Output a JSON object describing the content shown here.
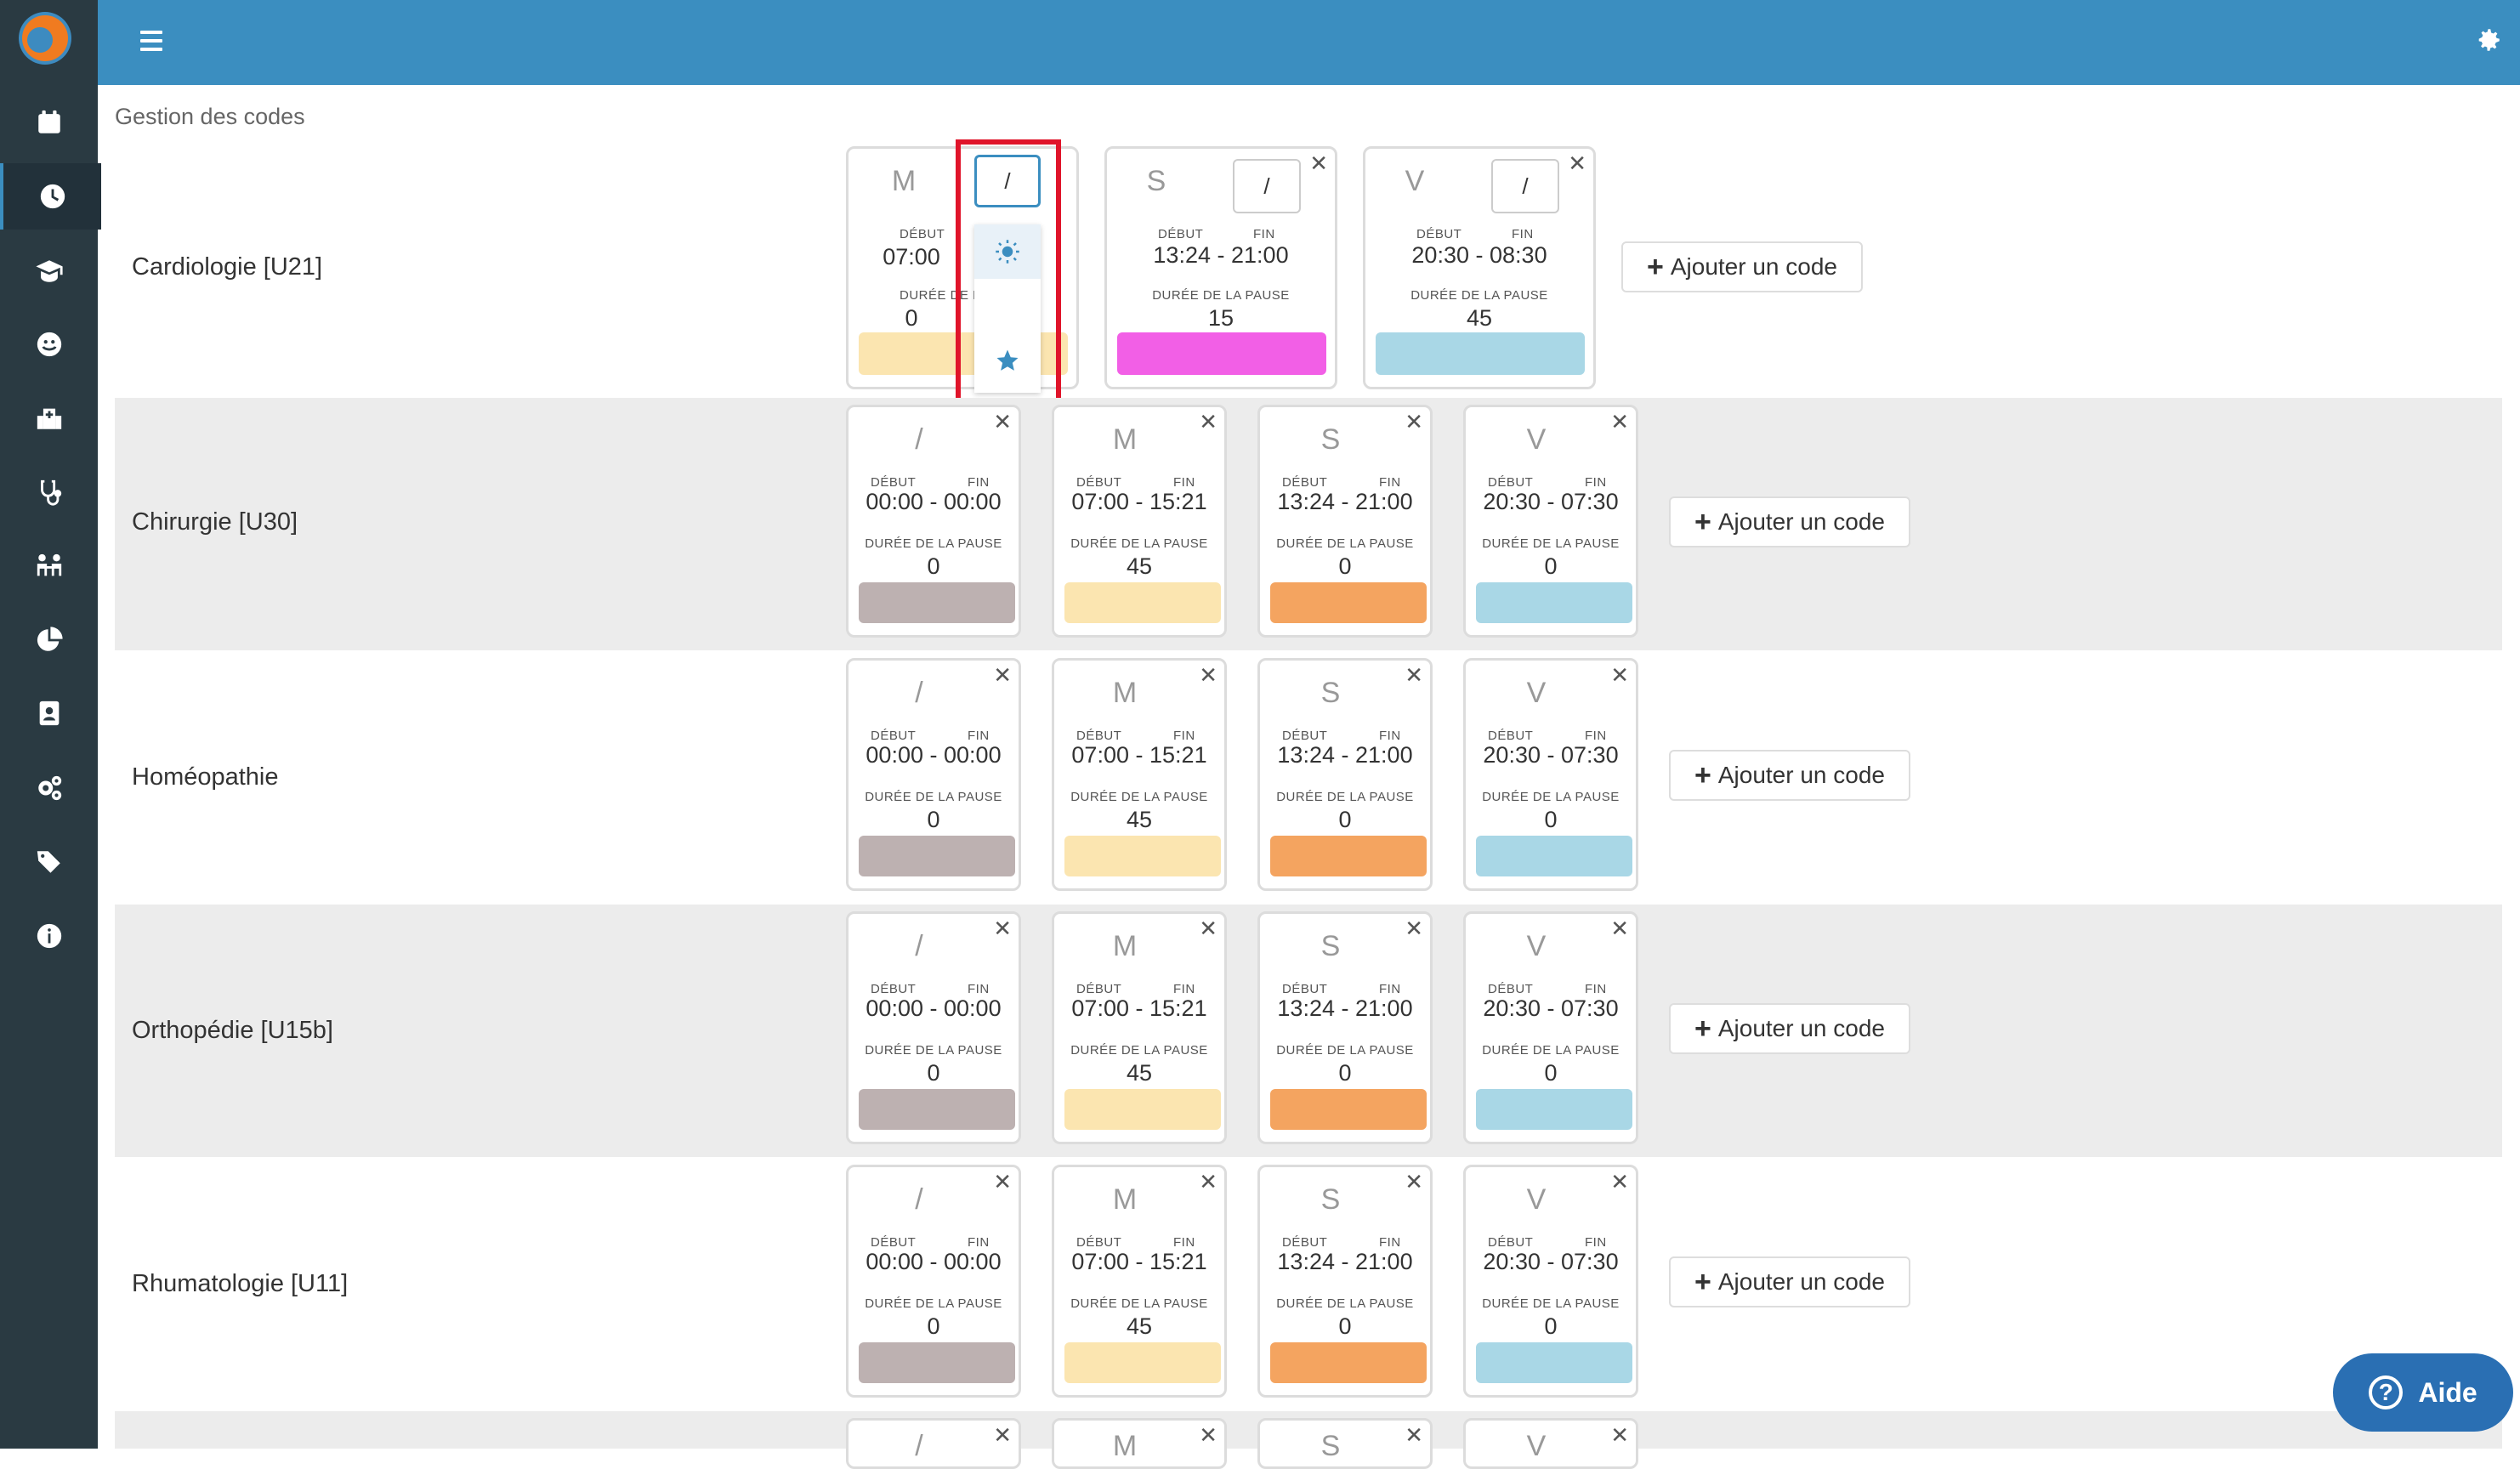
{
  "header": {
    "page_title": "Gestion des codes"
  },
  "labels": {
    "debut": "DÉBUT",
    "fin": "FIN",
    "duree": "DURÉE DE LA PAUSE",
    "dash": "-"
  },
  "add_code_label": "Ajouter un code",
  "help_label": "Aide",
  "sidebar_icons": [
    "calendar-icon",
    "clock-icon",
    "graduate-icon",
    "smiley-icon",
    "hospital-icon",
    "stethoscope-icon",
    "people-icon",
    "pie-chart-icon",
    "contact-book-icon",
    "cogs-icon",
    "tags-icon",
    "info-icon"
  ],
  "dropdown_icons": [
    "sun-icon",
    "moon-icon",
    "star-icon"
  ],
  "services": [
    {
      "name": "Cardiologie [U21]",
      "codes": [
        {
          "code": "M",
          "input": "/",
          "debut": "07:00",
          "fin": "",
          "pause": "0",
          "color": "#fbe5b0"
        },
        {
          "code": "S",
          "input": "/",
          "debut": "13:24",
          "fin": "21:00",
          "pause": "15",
          "color": "#f25fe6"
        },
        {
          "code": "V",
          "input": "/",
          "debut": "20:30",
          "fin": "08:30",
          "pause": "45",
          "color": "#a9d7e6"
        }
      ]
    },
    {
      "name": "Chirurgie [U30]",
      "codes": [
        {
          "code": "/",
          "debut": "00:00",
          "fin": "00:00",
          "pause": "0",
          "color": "#bdb1b1"
        },
        {
          "code": "M",
          "debut": "07:00",
          "fin": "15:21",
          "pause": "45",
          "color": "#fbe5b0"
        },
        {
          "code": "S",
          "debut": "13:24",
          "fin": "21:00",
          "pause": "0",
          "color": "#f4a460"
        },
        {
          "code": "V",
          "debut": "20:30",
          "fin": "07:30",
          "pause": "0",
          "color": "#a9d7e6"
        }
      ]
    },
    {
      "name": "Homéopathie",
      "codes": [
        {
          "code": "/",
          "debut": "00:00",
          "fin": "00:00",
          "pause": "0",
          "color": "#bdb1b1"
        },
        {
          "code": "M",
          "debut": "07:00",
          "fin": "15:21",
          "pause": "45",
          "color": "#fbe5b0"
        },
        {
          "code": "S",
          "debut": "13:24",
          "fin": "21:00",
          "pause": "0",
          "color": "#f4a460"
        },
        {
          "code": "V",
          "debut": "20:30",
          "fin": "07:30",
          "pause": "0",
          "color": "#a9d7e6"
        }
      ]
    },
    {
      "name": "Orthopédie [U15b]",
      "codes": [
        {
          "code": "/",
          "debut": "00:00",
          "fin": "00:00",
          "pause": "0",
          "color": "#bdb1b1"
        },
        {
          "code": "M",
          "debut": "07:00",
          "fin": "15:21",
          "pause": "45",
          "color": "#fbe5b0"
        },
        {
          "code": "S",
          "debut": "13:24",
          "fin": "21:00",
          "pause": "0",
          "color": "#f4a460"
        },
        {
          "code": "V",
          "debut": "20:30",
          "fin": "07:30",
          "pause": "0",
          "color": "#a9d7e6"
        }
      ]
    },
    {
      "name": "Rhumatologie [U11]",
      "codes": [
        {
          "code": "/",
          "debut": "00:00",
          "fin": "00:00",
          "pause": "0",
          "color": "#bdb1b1"
        },
        {
          "code": "M",
          "debut": "07:00",
          "fin": "15:21",
          "pause": "45",
          "color": "#fbe5b0"
        },
        {
          "code": "S",
          "debut": "13:24",
          "fin": "21:00",
          "pause": "0",
          "color": "#f4a460"
        },
        {
          "code": "V",
          "debut": "20:30",
          "fin": "07:30",
          "pause": "0",
          "color": "#a9d7e6"
        }
      ]
    },
    {
      "name": "",
      "codes": [
        {
          "code": "/",
          "debut": "",
          "fin": "",
          "pause": "",
          "color": ""
        },
        {
          "code": "M",
          "debut": "",
          "fin": "",
          "pause": "",
          "color": ""
        },
        {
          "code": "S",
          "debut": "",
          "fin": "",
          "pause": "",
          "color": ""
        },
        {
          "code": "V",
          "debut": "",
          "fin": "",
          "pause": "",
          "color": ""
        }
      ]
    }
  ],
  "colors": {
    "sidebar": "#2a3a42",
    "topbar": "#3b8ec0",
    "accent": "#3b8ec0",
    "highlight": "#e0142a",
    "help": "#2a6fb3"
  }
}
